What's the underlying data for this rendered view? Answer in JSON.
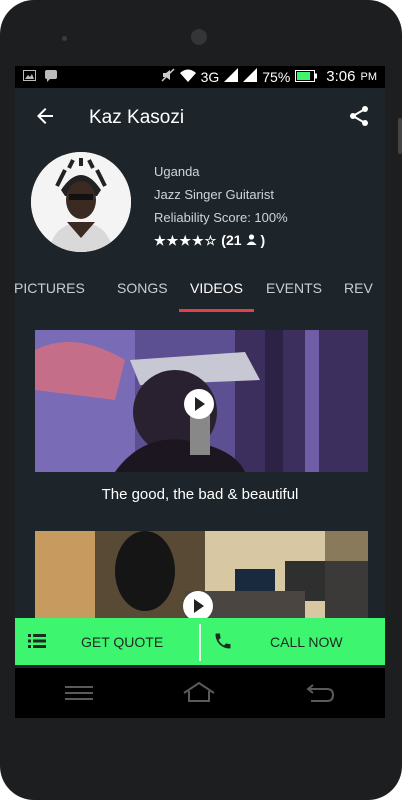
{
  "status_bar": {
    "network": "3G",
    "battery": "75%",
    "time": "3:06",
    "ampm": "PM"
  },
  "app_bar": {
    "title": "Kaz Kasozi"
  },
  "profile": {
    "country": "Uganda",
    "profession": "Jazz Singer Guitarist",
    "reliability": "Reliability Score: 100%",
    "rating_stars": 4,
    "rating_max": 5,
    "rating_count": "(21",
    "rating_suffix": ")"
  },
  "tabs": [
    {
      "label": "PICTURES"
    },
    {
      "label": "SONGS"
    },
    {
      "label": "VIDEOS"
    },
    {
      "label": "EVENTS"
    },
    {
      "label": "REV"
    }
  ],
  "videos": [
    {
      "caption": "The good, the bad & beautiful"
    },
    {
      "caption": ""
    }
  ],
  "actions": {
    "quote_label": "GET QUOTE",
    "call_label": "CALL NOW"
  },
  "colors": {
    "accent": "#e0404a",
    "action_bar": "#3ef56f",
    "background": "#1e252a"
  }
}
